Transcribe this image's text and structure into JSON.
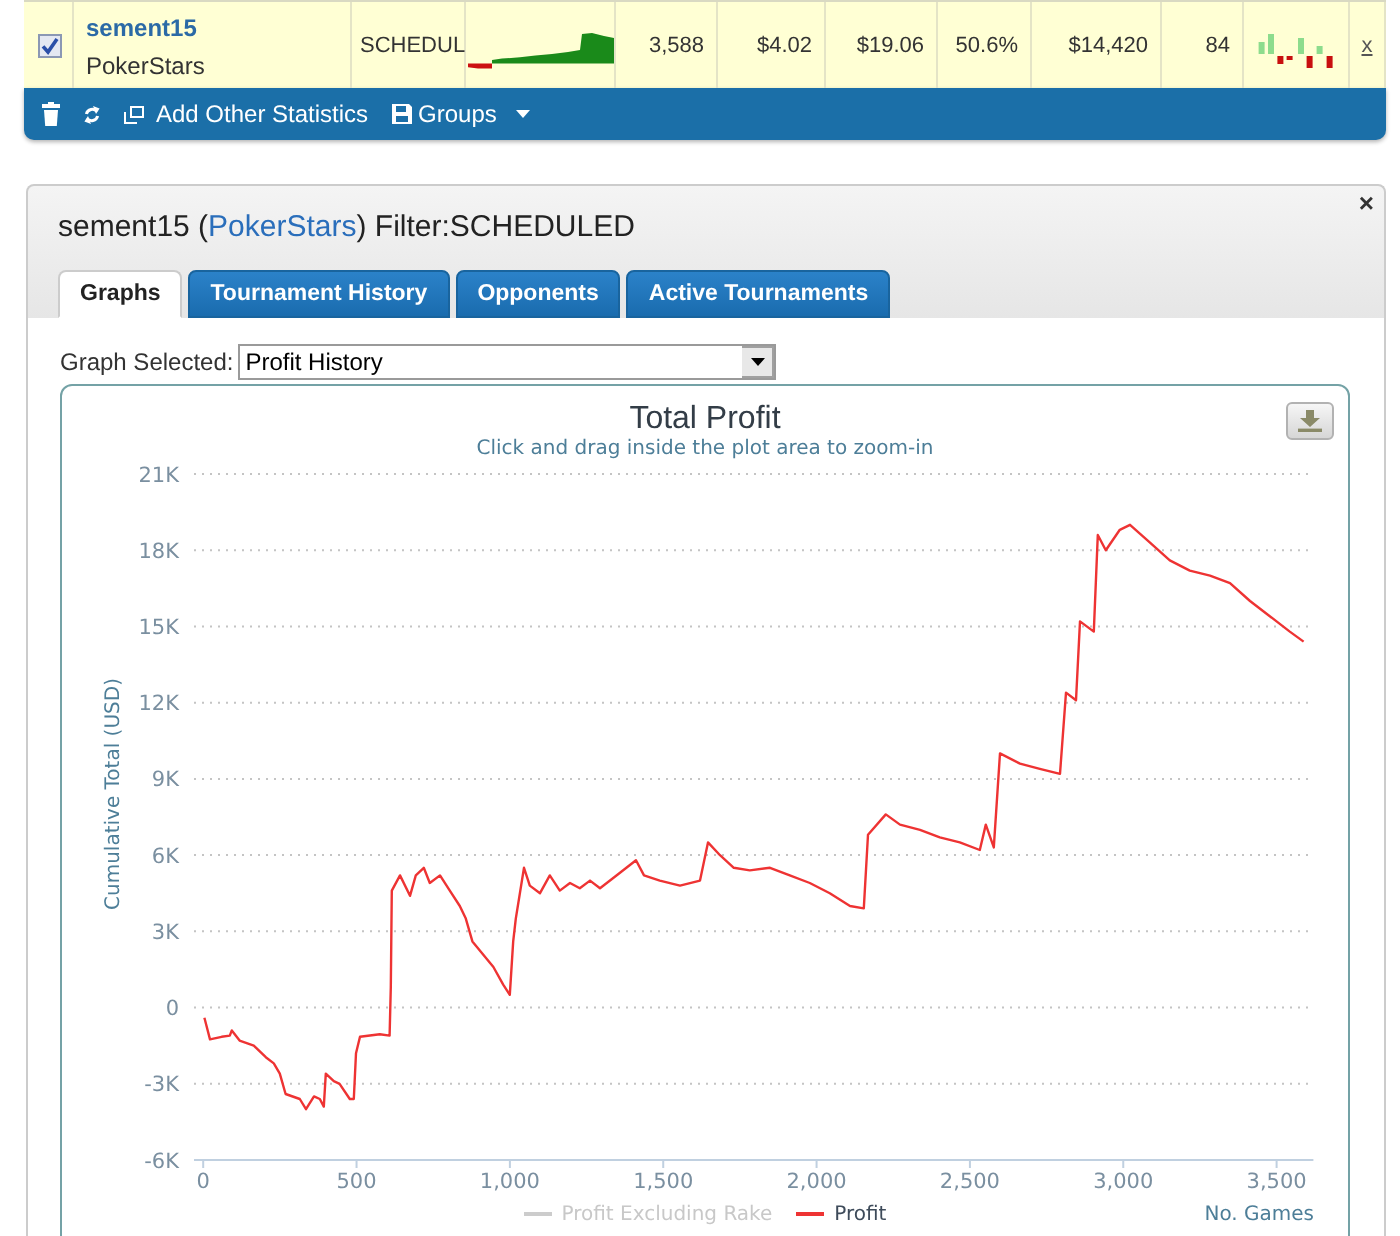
{
  "stats_row": {
    "checked": true,
    "player": "sement15",
    "site": "PokerStars",
    "type": "SCHEDUL",
    "cells": [
      "3,588",
      "$4.02",
      "$19.06",
      "50.6%",
      "$14,420",
      "84"
    ],
    "remove": "x"
  },
  "toolbar": {
    "add_label": "Add Other Statistics",
    "groups_label": "Groups"
  },
  "panel": {
    "title": {
      "before": "sement15 (",
      "link": "PokerStars",
      "after": ") Filter:SCHEDULED"
    },
    "close": "×",
    "tabs": [
      {
        "label": "Graphs",
        "selected": true
      },
      {
        "label": "Tournament History",
        "selected": false
      },
      {
        "label": "Opponents",
        "selected": false
      },
      {
        "label": "Active Tournaments",
        "selected": false
      }
    ],
    "graph_selector": {
      "label": "Graph Selected:",
      "value": "Profit History"
    },
    "chart": {
      "subtitle": "Click and drag inside the plot area to zoom-in",
      "hidden_series": [
        {
          "name": "Profit Excluding Rake"
        }
      ],
      "chart_data": {
        "type": "line",
        "title": "Total Profit",
        "xlabel": "No. Games",
        "ylabel": "Cumulative Total (USD)",
        "grid": true,
        "x": [
          4,
          22,
          60,
          87,
          93,
          119,
          165,
          204,
          230,
          250,
          269,
          315,
          335,
          361,
          380,
          393,
          400,
          426,
          445,
          478,
          491,
          498,
          511,
          576,
          608,
          612,
          615,
          642,
          674,
          693,
          719,
          739,
          772,
          804,
          837,
          856,
          878,
          946,
          978,
          1000,
          1011,
          1019,
          1046,
          1065,
          1098,
          1130,
          1163,
          1196,
          1228,
          1261,
          1294,
          1359,
          1411,
          1437,
          1489,
          1555,
          1620,
          1646,
          1685,
          1730,
          1782,
          1848,
          1913,
          1978,
          2043,
          2109,
          2154,
          2168,
          2226,
          2272,
          2337,
          2402,
          2467,
          2532,
          2552,
          2578,
          2598,
          2663,
          2728,
          2794,
          2813,
          2846,
          2859,
          2904,
          2917,
          2943,
          2989,
          3022,
          3087,
          3152,
          3217,
          3283,
          3348,
          3413,
          3478,
          3543,
          3588
        ],
        "series": [
          {
            "name": "Profit",
            "color": "#ee3333",
            "values": [
              -400,
              -1250,
              -1150,
              -1100,
              -900,
              -1300,
              -1500,
              -1950,
              -2200,
              -2600,
              -3400,
              -3600,
              -4000,
              -3500,
              -3600,
              -3900,
              -2600,
              -2900,
              -3000,
              -3600,
              -3600,
              -1800,
              -1150,
              -1050,
              -1100,
              800,
              4600,
              5200,
              4400,
              5200,
              5500,
              4900,
              5200,
              4600,
              4000,
              3500,
              2600,
              1600,
              900,
              500,
              2600,
              3500,
              5500,
              4800,
              4500,
              5200,
              4600,
              4900,
              4700,
              5000,
              4700,
              5300,
              5800,
              5200,
              5000,
              4800,
              5000,
              6500,
              6000,
              5500,
              5400,
              5500,
              5200,
              4900,
              4500,
              4000,
              3900,
              6800,
              7600,
              7200,
              7000,
              6700,
              6500,
              6200,
              7200,
              6300,
              10000,
              9600,
              9400,
              9200,
              12400,
              12100,
              15200,
              14800,
              18600,
              18000,
              18800,
              19000,
              18300,
              17600,
              17200,
              17000,
              16700,
              16000,
              15400,
              14800,
              14400
            ]
          }
        ],
        "xlim": [
          -30,
          3620
        ],
        "ylim": [
          -6000,
          21000
        ],
        "xticks": [
          {
            "value": 0,
            "label": "0"
          },
          {
            "value": 500,
            "label": "500"
          },
          {
            "value": 1000,
            "label": "1,000"
          },
          {
            "value": 1500,
            "label": "1,500"
          },
          {
            "value": 2000,
            "label": "2,000"
          },
          {
            "value": 2500,
            "label": "2,500"
          },
          {
            "value": 3000,
            "label": "3,000"
          },
          {
            "value": 3500,
            "label": "3,500"
          }
        ],
        "yticks": [
          {
            "value": -6000,
            "label": "-6K"
          },
          {
            "value": -3000,
            "label": "-3K"
          },
          {
            "value": 0,
            "label": "0"
          },
          {
            "value": 3000,
            "label": "3K"
          },
          {
            "value": 6000,
            "label": "6K"
          },
          {
            "value": 9000,
            "label": "9K"
          },
          {
            "value": 12000,
            "label": "12K"
          },
          {
            "value": 15000,
            "label": "15K"
          },
          {
            "value": 18000,
            "label": "18K"
          },
          {
            "value": 21000,
            "label": "21K"
          }
        ]
      }
    }
  }
}
